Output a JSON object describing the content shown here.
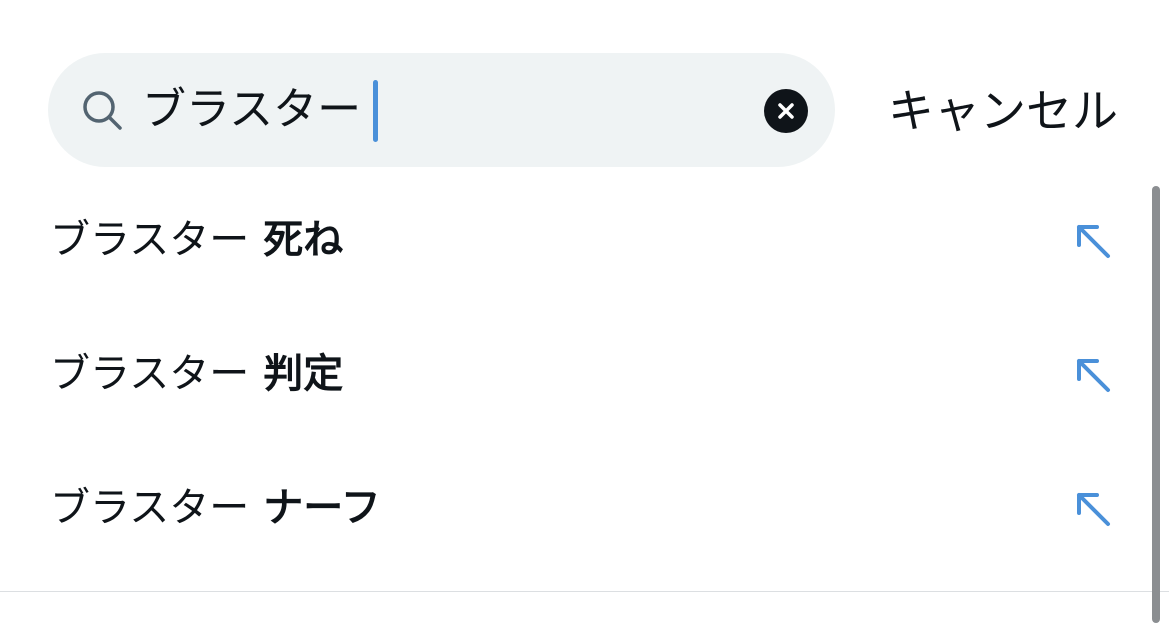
{
  "search": {
    "query": "ブラスター",
    "cancel_label": "キャンセル"
  },
  "suggestions": [
    {
      "prefix": "ブラスター",
      "completion": "死ね"
    },
    {
      "prefix": "ブラスター",
      "completion": "判定"
    },
    {
      "prefix": "ブラスター",
      "completion": "ナーフ"
    }
  ],
  "icons": {
    "search": "search-icon",
    "clear": "close-circle-icon",
    "fill": "arrow-up-left-icon"
  },
  "colors": {
    "accent": "#4a90d9",
    "search_bg": "#eff3f4",
    "text": "#0f1419"
  }
}
